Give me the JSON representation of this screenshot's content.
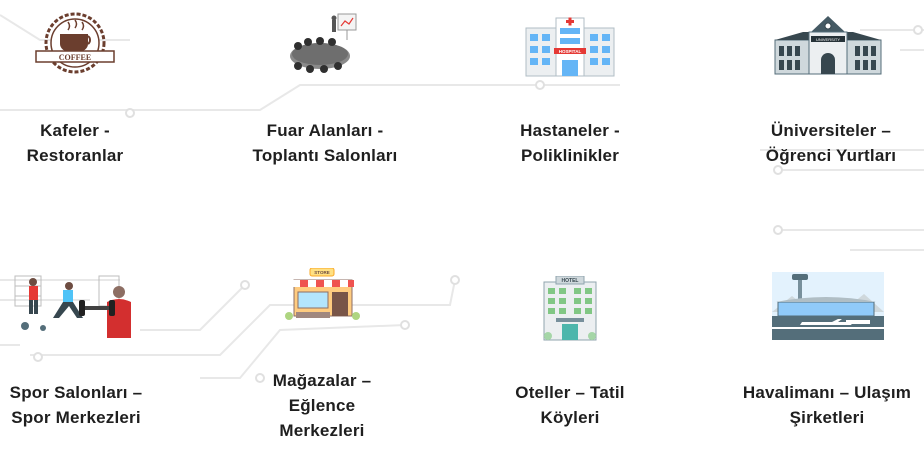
{
  "items": [
    {
      "id": "kafeler",
      "line1": "Kafeler -",
      "line2": "Restoranlar",
      "icon": "coffee-badge-icon",
      "badge_text": "COFFEE"
    },
    {
      "id": "fuar",
      "line1": "Fuar Alanları -",
      "line2": "Toplantı Salonları",
      "icon": "meeting-table-icon"
    },
    {
      "id": "hastane",
      "line1": "Hastaneler -",
      "line2": "Poliklinikler",
      "icon": "hospital-building-icon",
      "sign_text": "HOSPITAL"
    },
    {
      "id": "universite",
      "line1": "Üniversiteler –",
      "line2": "Öğrenci Yurtları",
      "icon": "university-building-icon",
      "sign_text": "UNIVERSITY"
    },
    {
      "id": "spor",
      "line1": "Spor Salonları –",
      "line2": "Spor Merkezleri",
      "icon": "gym-people-icon"
    },
    {
      "id": "magaza",
      "line1": "Mağazalar –",
      "line2": "Eğlence",
      "line3": "Merkezleri",
      "icon": "store-front-icon",
      "sign_text": "STORE"
    },
    {
      "id": "otel",
      "line1": "Oteller – Tatil",
      "line2": "Köyleri",
      "icon": "hotel-building-icon",
      "sign_text": "HOTEL"
    },
    {
      "id": "havalimani",
      "line1": "Havalimanı – Ulaşım",
      "line2": "Şirketleri",
      "icon": "airport-terminal-icon"
    }
  ],
  "colors": {
    "text": "#1f1f1f",
    "lines": "#e6e6e6",
    "coffee_brown": "#6b3e2e",
    "hospital_red": "#e53935"
  }
}
